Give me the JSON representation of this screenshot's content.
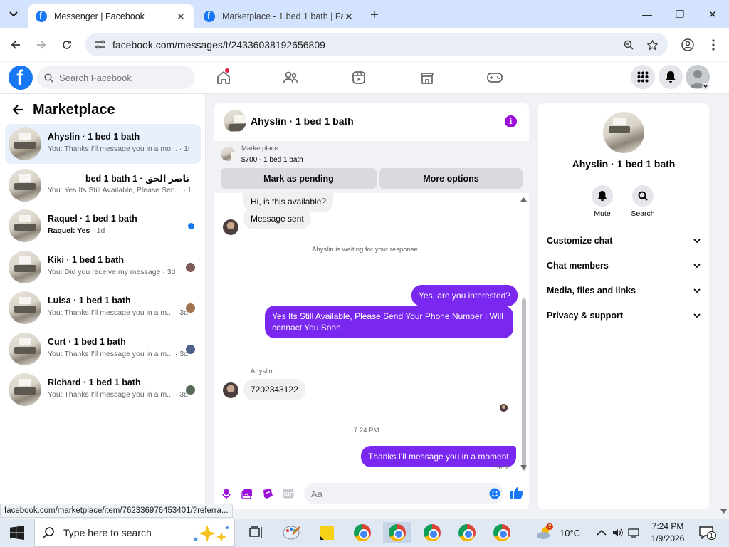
{
  "browser": {
    "tabs": [
      {
        "title": "Messenger | Facebook",
        "active": true
      },
      {
        "title": "Marketplace - 1 bed 1 bath | Fa",
        "active": false
      }
    ],
    "url": "facebook.com/messages/t/24336038192656809"
  },
  "header": {
    "search_placeholder": "Search Facebook",
    "nav_icons": [
      "home-icon",
      "friends-icon",
      "watch-icon",
      "marketplace-icon",
      "gaming-icon"
    ],
    "right_icons": [
      "menu-grid-icon",
      "notifications-bell-icon",
      "profile-avatar"
    ]
  },
  "left": {
    "title": "Marketplace",
    "conversations": [
      {
        "name": "Ahyslin · 1 bed 1 bath",
        "snippet": "You: Thanks I'll message you in a mo...",
        "time": "· 1m",
        "selected": true
      },
      {
        "name": "ناصر الحق · 1 bed 1 bath",
        "snippet": "You: Yes Its Still Available, Please Sen...",
        "time": "· 1m"
      },
      {
        "name": "Raquel · 1 bed 1 bath",
        "snippet_bold": "Raquel: Yes",
        "time": "· 1d",
        "unread": true
      },
      {
        "name": "Kiki · 1 bed 1 bath",
        "snippet": "You: Did you receive my message",
        "time": "· 3d"
      },
      {
        "name": "Luisa · 1 bed 1 bath",
        "snippet": "You: Thanks I'll message you in a m...",
        "time": "· 3d"
      },
      {
        "name": "Curt · 1 bed 1 bath",
        "snippet": "You: Thanks I'll message you in a m...",
        "time": "· 3d"
      },
      {
        "name": "Richard · 1 bed 1 bath",
        "snippet": "You: Thanks I'll message you in a m...",
        "time": "· 3d"
      }
    ]
  },
  "chat": {
    "title": "Ahyslin · 1 bed 1 bath",
    "listing_source": "Marketplace",
    "listing_detail": "$700 - 1 bed 1 bath",
    "btn_pending": "Mark as pending",
    "btn_more": "More options",
    "messages": {
      "m1": "Hi, is this available?",
      "m2": "Message sent",
      "waiting": "Ahyslin is waiting for your response.",
      "m3": "Yes, are you interested?",
      "m4": "Yes Its Still Available, Please Send Your Phone Number I Will connact You Soon",
      "sender": "Ahyslin",
      "m5": "7202343122",
      "time": "7:24 PM",
      "m6": "Thanks I'll message you in a moment",
      "sent": "Sent"
    },
    "composer_placeholder": "Aa"
  },
  "info": {
    "name": "Ahyslin · 1 bed 1 bath",
    "actions": {
      "mute": "Mute",
      "search": "Search"
    },
    "sections": [
      "Customize chat",
      "Chat members",
      "Media, files and links",
      "Privacy & support"
    ]
  },
  "status_url": "facebook.com/marketplace/item/762336976453401/?referra...",
  "taskbar": {
    "search_text": "Type here to search",
    "weather": "10°C",
    "weather_badge": "2",
    "time": "7:24 PM",
    "date": "1/9/2026",
    "notif_count": "1"
  },
  "colors": {
    "accent": "#7a28f0",
    "fb_blue": "#1877f2",
    "info_purple": "#9b0fd8"
  }
}
